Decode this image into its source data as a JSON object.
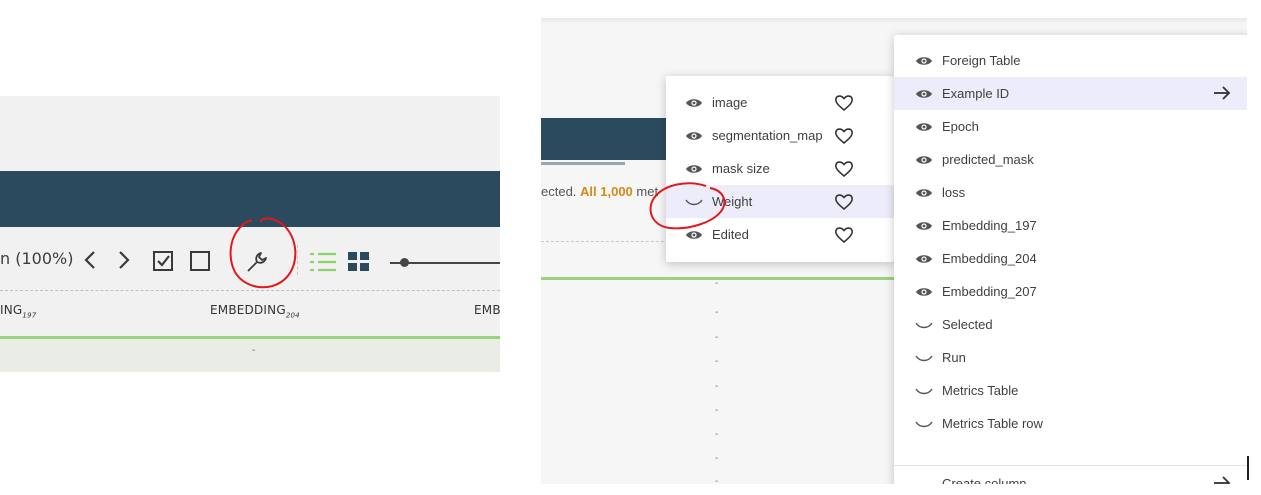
{
  "left": {
    "zoom_text": "n (100%)",
    "columns": [
      {
        "label": "ING",
        "sub": "197"
      },
      {
        "label": "EMBEDDING",
        "sub": "204"
      },
      {
        "label": "EMB",
        "sub": ""
      }
    ],
    "row_dash": "-"
  },
  "right": {
    "selected_prefix": "ected. ",
    "selected_highlight": "All 1,000",
    "selected_suffix": " met",
    "row_dash": "-",
    "small_menu": [
      {
        "label": "image",
        "icon": "eye-icon"
      },
      {
        "label": "segmentation_map",
        "icon": "eye-icon"
      },
      {
        "label": "mask size",
        "icon": "eye-icon"
      },
      {
        "label": "Weight",
        "icon": "eye-closed-icon"
      },
      {
        "label": "Edited",
        "icon": "eye-icon"
      }
    ],
    "large_menu": [
      {
        "label": "Foreign Table",
        "icon": "eye-icon"
      },
      {
        "label": "Example ID",
        "icon": "eye-icon"
      },
      {
        "label": "Epoch",
        "icon": "eye-icon"
      },
      {
        "label": "predicted_mask",
        "icon": "eye-icon"
      },
      {
        "label": "loss",
        "icon": "eye-icon"
      },
      {
        "label": "Embedding_197",
        "icon": "eye-icon"
      },
      {
        "label": "Embedding_204",
        "icon": "eye-icon"
      },
      {
        "label": "Embedding_207",
        "icon": "eye-icon"
      },
      {
        "label": "Selected",
        "icon": "eye-closed-icon"
      },
      {
        "label": "Run",
        "icon": "eye-closed-icon"
      },
      {
        "label": "Metrics Table",
        "icon": "eye-closed-icon"
      },
      {
        "label": "Metrics Table row",
        "icon": "eye-closed-icon"
      }
    ],
    "create_column": "Create column"
  },
  "colors": {
    "header_bar": "#2c4a5e",
    "accent_green": "#9bd27c",
    "highlight_row": "#ececfa",
    "annotation_red": "#e0191b",
    "orange_text": "#d48a17"
  }
}
